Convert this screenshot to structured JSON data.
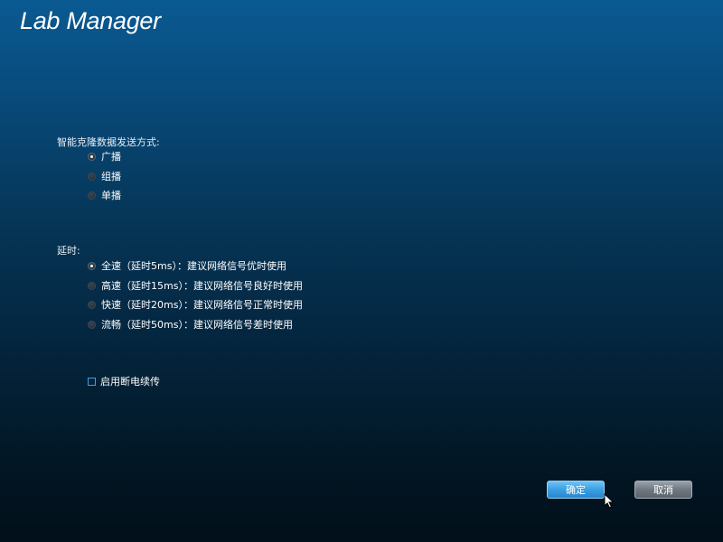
{
  "app": {
    "title": "Lab Manager"
  },
  "clone_send_mode": {
    "label": "智能克隆数据发送方式:",
    "options": [
      {
        "label": "广播",
        "selected": true
      },
      {
        "label": "组播",
        "selected": false
      },
      {
        "label": "单播",
        "selected": false
      }
    ]
  },
  "delay": {
    "label": "延时:",
    "options": [
      {
        "label": "全速（延时5ms）：建议网络信号优时使用",
        "selected": true
      },
      {
        "label": "高速（延时15ms）：建议网络信号良好时使用",
        "selected": false
      },
      {
        "label": "快速（延时20ms）：建议网络信号正常时使用",
        "selected": false
      },
      {
        "label": "流畅（延时50ms）：建议网络信号差时使用",
        "selected": false
      }
    ]
  },
  "resume_transfer": {
    "label": "启用断电续传",
    "checked": false
  },
  "buttons": {
    "ok_label": "确定",
    "cancel_label": "取消"
  },
  "colors": {
    "background_top": "#0a5a92",
    "background_bottom": "#01101a",
    "primary_button": "#3a9fe2",
    "secondary_button": "#6f7880",
    "checkbox_border": "#3aa0e6"
  },
  "icons": {
    "cursor": "mouse-pointer-icon"
  }
}
